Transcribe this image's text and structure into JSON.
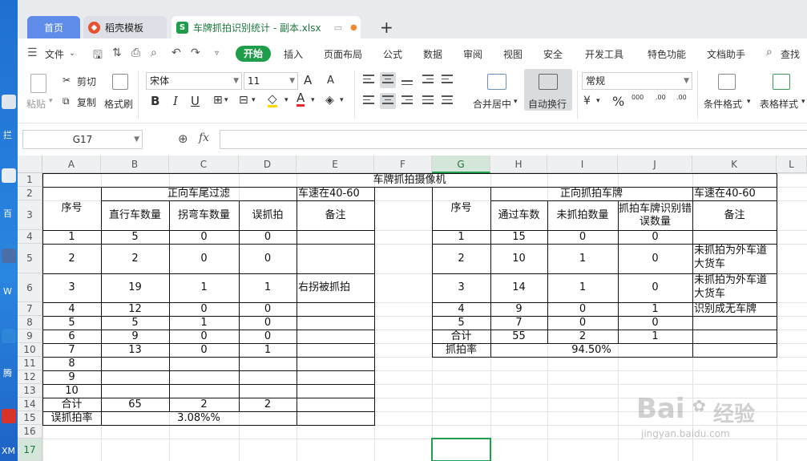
{
  "desktop": {
    "labels": [
      "拦",
      "百",
      "W",
      "腾",
      "XM"
    ]
  },
  "tabs": {
    "home": "首页",
    "template": "稻壳模板",
    "file": "车牌抓拍识别统计 - 副本.xlsx"
  },
  "menu": {
    "file": "文件",
    "items": [
      "开始",
      "插入",
      "页面布局",
      "公式",
      "数据",
      "审阅",
      "视图",
      "安全",
      "开发工具",
      "特色功能",
      "文档助手",
      "查找"
    ]
  },
  "ribbon": {
    "paste": "粘贴",
    "cut": "剪切",
    "copy": "复制",
    "format_painter": "格式刷",
    "font_name": "宋体",
    "font_size": "11",
    "merge_center": "合并居中",
    "wrap_text": "自动换行",
    "number_format": "常规",
    "cond_format": "条件格式",
    "table_style": "表格样式",
    "bold": "B",
    "italic": "I",
    "underline": "U",
    "font_color": "A",
    "inc_font": "A",
    "dec_font": "A",
    "percent": "%",
    "thousands": "000",
    "inc_dec": ".00",
    "dec_dec": ".00"
  },
  "formula_bar": {
    "name_box": "G17",
    "fx": "fx",
    "content": ""
  },
  "columns": [
    "A",
    "B",
    "C",
    "D",
    "E",
    "F",
    "G",
    "H",
    "I",
    "J",
    "K",
    "L"
  ],
  "selected_column": "G",
  "selected_row": "17",
  "rows": [
    "1",
    "2",
    "3",
    "4",
    "5",
    "6",
    "7",
    "8",
    "9",
    "10",
    "11",
    "12",
    "13",
    "14",
    "15",
    "16",
    "17"
  ],
  "sheet": {
    "title": "车牌抓拍摄像机",
    "left": {
      "group": "正向车尾过滤",
      "speed": "车速在40-60",
      "headers": [
        "序号",
        "直行车数量",
        "拐弯车数量",
        "误抓拍",
        "备注"
      ],
      "rows": [
        [
          "1",
          "5",
          "0",
          "0",
          ""
        ],
        [
          "2",
          "2",
          "0",
          "0",
          ""
        ],
        [
          "3",
          "19",
          "1",
          "1",
          "右拐被抓拍"
        ],
        [
          "4",
          "12",
          "0",
          "0",
          ""
        ],
        [
          "5",
          "5",
          "1",
          "0",
          ""
        ],
        [
          "6",
          "9",
          "0",
          "0",
          ""
        ],
        [
          "7",
          "13",
          "0",
          "1",
          ""
        ],
        [
          "8",
          "",
          "",
          "",
          ""
        ],
        [
          "9",
          "",
          "",
          "",
          ""
        ],
        [
          "10",
          "",
          "",
          "",
          ""
        ]
      ],
      "total": [
        "合计",
        "65",
        "2",
        "2",
        ""
      ],
      "rate_label": "误抓拍率",
      "rate_value": "3.08%%"
    },
    "right": {
      "group": "正向抓拍车牌",
      "speed": "车速在40-60",
      "headers": [
        "序号",
        "通过车数",
        "未抓拍数量",
        "抓拍车牌识别错误数量",
        "备注"
      ],
      "rows": [
        [
          "1",
          "15",
          "0",
          "0",
          ""
        ],
        [
          "2",
          "10",
          "1",
          "0",
          "未抓拍为外车道大货车"
        ],
        [
          "3",
          "14",
          "1",
          "0",
          "未抓拍为外车道大货车"
        ],
        [
          "4",
          "9",
          "0",
          "1",
          "识别成无车牌"
        ],
        [
          "5",
          "7",
          "0",
          "0",
          ""
        ]
      ],
      "total": [
        "合计",
        "55",
        "2",
        "1",
        ""
      ],
      "rate_label": "抓拍率",
      "rate_value": "94.50%"
    }
  },
  "watermark": {
    "brand": "Bai",
    "brand2": "经验",
    "url": "jingyan.baidu.com"
  }
}
